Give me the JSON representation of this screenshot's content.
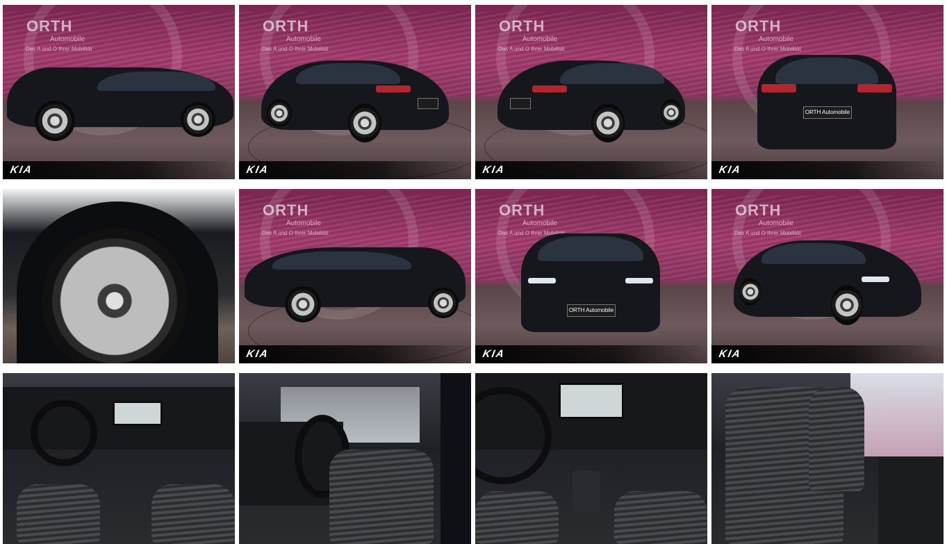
{
  "gallery": {
    "brand_name": "ORTH",
    "brand_sub": "Automobile",
    "brand_tagline": "Das A und O Ihrer Mobilität",
    "logo_text": "KIA",
    "plate_text": "ORTH Automobile",
    "tiles": [
      {
        "view": "side-left"
      },
      {
        "view": "rear-three-quarter-left"
      },
      {
        "view": "rear-three-quarter-right"
      },
      {
        "view": "rear"
      },
      {
        "view": "wheel-closeup"
      },
      {
        "view": "side-right"
      },
      {
        "view": "front"
      },
      {
        "view": "front-three-quarter-right"
      },
      {
        "view": "interior-dashboard"
      },
      {
        "view": "interior-driver-door"
      },
      {
        "view": "interior-center-console"
      },
      {
        "view": "interior-passenger-seat"
      }
    ]
  },
  "colors": {
    "backdrop_magenta": "#a23a6c",
    "car_body": "#15171d",
    "taillight": "#b2262f"
  }
}
